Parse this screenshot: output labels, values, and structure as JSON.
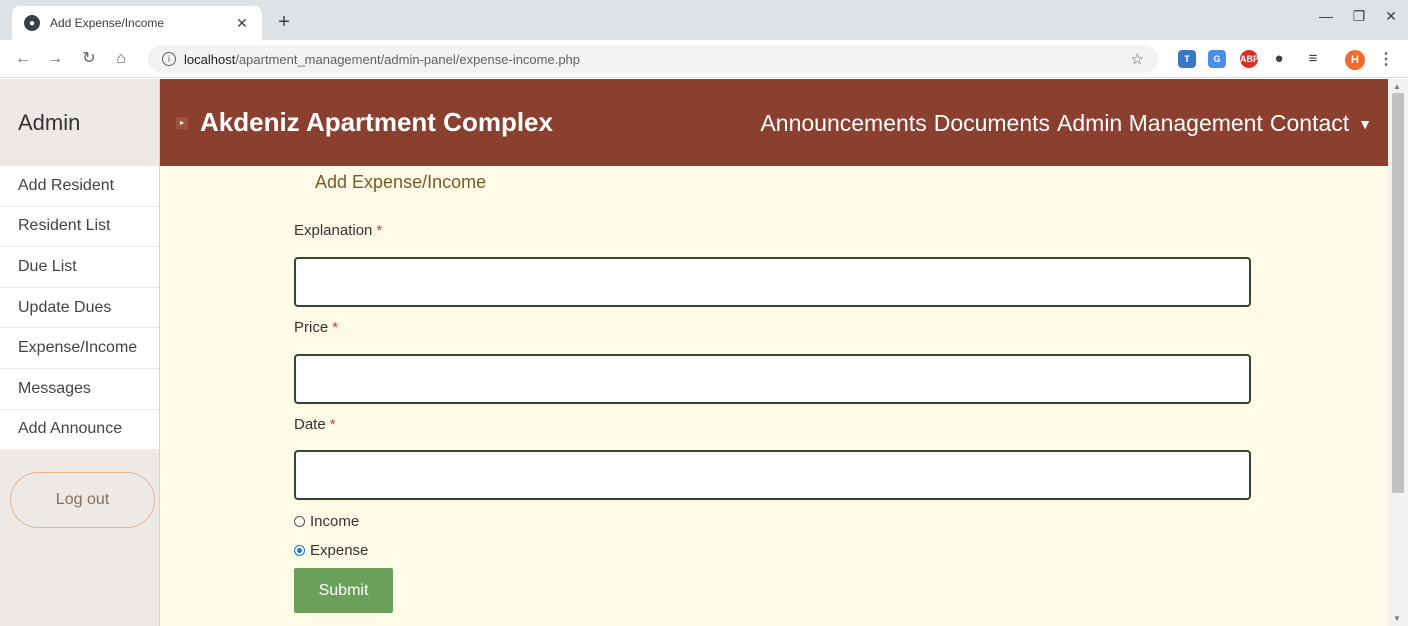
{
  "browser": {
    "tab_title": "Add Expense/Income",
    "url_host": "localhost",
    "url_path": "/apartment_management/admin-panel/expense-income.php",
    "avatar_letter": "H"
  },
  "sidebar": {
    "title": "Admin",
    "items": [
      {
        "label": "Add Resident"
      },
      {
        "label": "Resident List"
      },
      {
        "label": "Due List"
      },
      {
        "label": "Update Dues"
      },
      {
        "label": "Expense/Income"
      },
      {
        "label": "Messages"
      },
      {
        "label": "Add Announce"
      }
    ],
    "logout_label": "Log out"
  },
  "header": {
    "brand": "Akdeniz Apartment Complex",
    "nav": [
      "Announcements",
      "Documents",
      "Admin Management",
      "Contact"
    ],
    "color": "#8b3f2f"
  },
  "form": {
    "title": "Add Expense/Income",
    "explanation_label": "Explanation",
    "price_label": "Price",
    "date_label": "Date",
    "required_mark": "*",
    "explanation_value": "",
    "price_value": "",
    "date_value": "",
    "radio_income": "Income",
    "radio_expense": "Expense",
    "selected": "Expense",
    "submit_label": "Submit"
  }
}
